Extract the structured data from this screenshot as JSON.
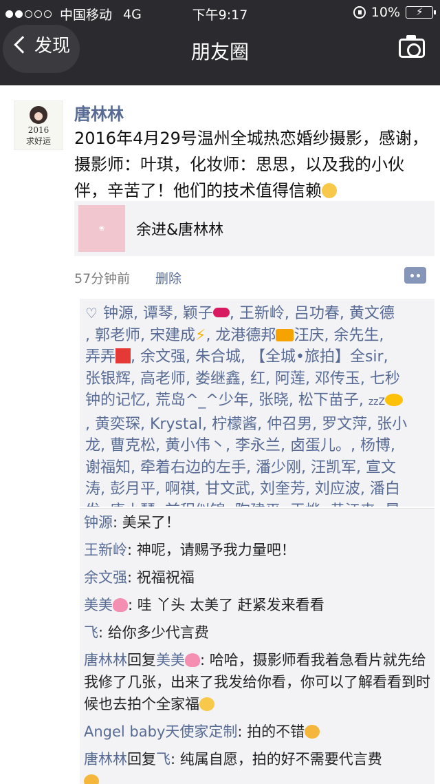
{
  "status_bar": {
    "carrier": "中国移动",
    "network": "4G",
    "time": "下午9:17",
    "battery": "10%"
  },
  "nav": {
    "back_label": "发现",
    "title": "朋友圈",
    "icons": [
      "chevron-left-icon",
      "camera-icon"
    ]
  },
  "post": {
    "avatar_text": {
      "year": "2016",
      "wish": "求好运"
    },
    "username": "唐林林",
    "content": "2016年4月29号温州全城热恋婚纱摄影，感谢，摄影师：叶琪，化妆师：思思，以及我的小伙伴，辛苦了！他们的技术值得信赖",
    "link_card": {
      "title": "余进&唐林林"
    },
    "time_ago": "57分钟前",
    "delete_label": "删除"
  },
  "likes": {
    "icon": "heart-outline-icon",
    "names": [
      "钟源",
      "谭琴",
      "颖子💋",
      "王新岭",
      "吕功春",
      "黄文德",
      "郭老师",
      "宋建成⚡",
      "龙港德邦🚚汪庆",
      "余先生",
      "弄弄💢",
      "余文强",
      "朱合城",
      "【全城•旅拍】全sir",
      "张银辉",
      "高老师",
      "娄继鑫",
      "红",
      "阿莲",
      "邓传玉",
      "七秒钟的记忆",
      "荒岛^_^少年",
      "张晓",
      "松下苗子💤🐠",
      "黄奕琛",
      "Krystal",
      "柠檬酱",
      "仲召男",
      "罗文萍",
      "张小龙",
      "曹克松",
      "黄小伟丶",
      "李永兰",
      "卤蛋儿。",
      "杨博",
      "谢福知",
      "牵着右边的左手",
      "潘少刚",
      "汪凯军",
      "宣文涛",
      "彭月平",
      "啊祺",
      "甘文武",
      "刘奎芳",
      "刘应波",
      "潘白发",
      "唐小琴",
      "前程似锦",
      "陶建平",
      "王烨",
      "黄江来",
      "晨"
    ],
    "lines": [
      "钟源, 谭琴, 颖子",
      ", 王新岭, 吕功春, 黄文德",
      ", 郭老师, 宋建成",
      ", 龙港德邦",
      "汪庆, 余先生,",
      "弄弄",
      ", 余文强, 朱合城, 【全城•旅拍】全sir,",
      "张银辉, 高老师, 娄继鑫, 红, 阿莲, 邓传玉, 七秒",
      "钟的记忆, 荒岛^_^少年, 张晓, 松下苗子,",
      ", 黄奕琛, Krystal, 柠檬酱, 仲召男, 罗文萍, 张小",
      "龙, 曹克松, 黄小伟丶, 李永兰, 卤蛋儿。, 杨博,",
      "谢福知, 牵着右边的左手, 潘少刚, 汪凯军, 宣文",
      "涛, 彭月平, 啊祺, 甘文武, 刘奎芳, 刘应波, 潘白",
      "发, 唐小琴, 前程似锦, 陶建平, 王烨, 黄江来, 晨"
    ]
  },
  "comments": [
    {
      "name": "钟源",
      "text": ": 美呆了！"
    },
    {
      "name": "王新岭",
      "text": ": 神呢，请赐予我力量吧！"
    },
    {
      "name": "余文强",
      "text": ": 祝福祝福"
    },
    {
      "name": "美美",
      "text": ": 哇 丫头 太美了 赶紧发来看看"
    },
    {
      "name": "飞",
      "text": ": 给你多少代言费"
    },
    {
      "name": "唐林林",
      "reply": "回复",
      "to": "美美",
      "text": ": 哈哈，摄影师看我着急看片就先给我修了几张，出来了我发给你看，你可以了解看看到时候也去拍个全家福"
    },
    {
      "name": "Angel baby天使家定制",
      "text": ": 拍的不错"
    },
    {
      "name": "唐林林",
      "reply": "回复",
      "to": "飞",
      "text": ": 纯属自愿，拍的好不需要代言费"
    }
  ],
  "colors": {
    "nav_bg": "#2b2b2f",
    "link_blue": "#576b95",
    "panel_bg": "#f3f3f5"
  }
}
